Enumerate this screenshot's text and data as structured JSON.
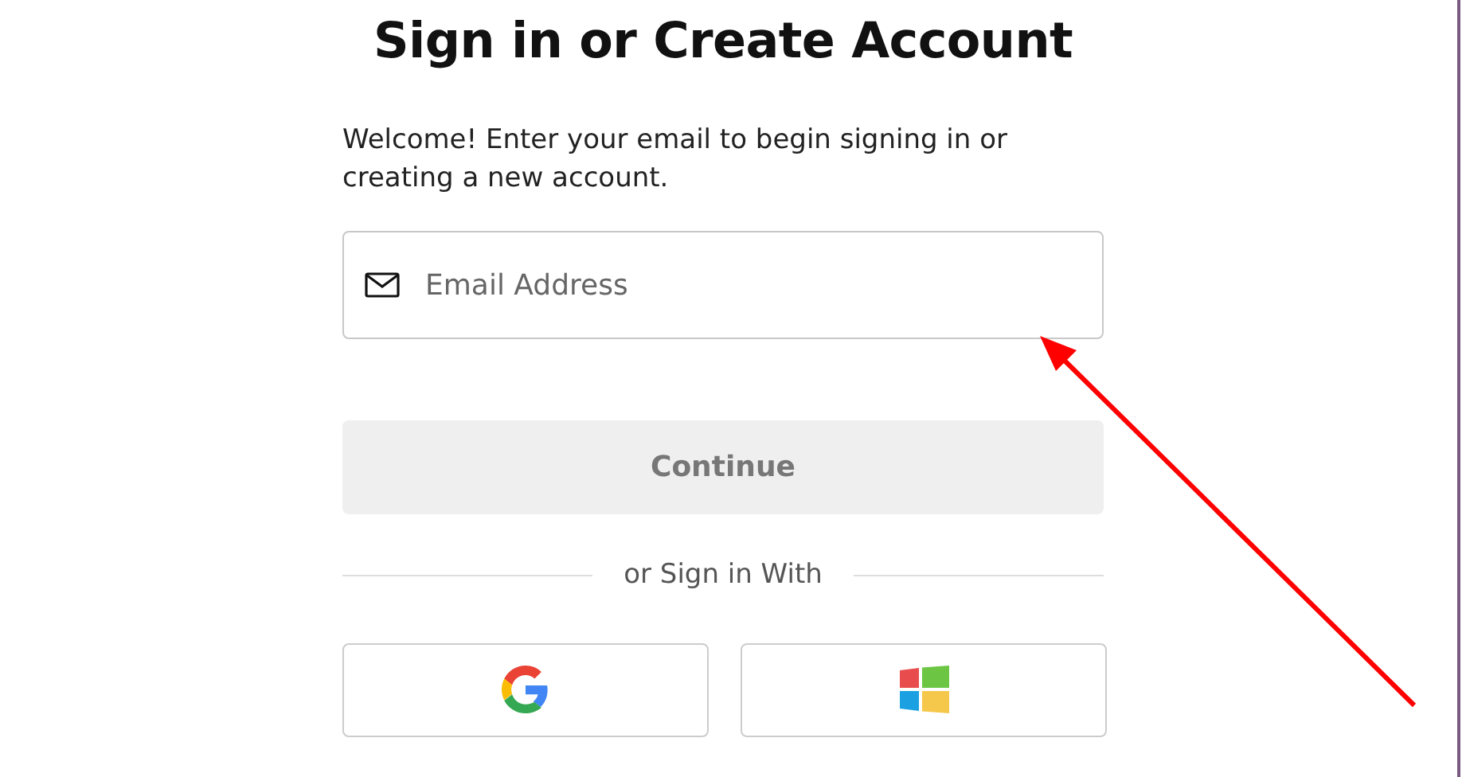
{
  "title": "Sign in or Create Account",
  "intro": "Welcome! Enter your email to begin signing in or creating a new account.",
  "email_field": {
    "placeholder": "Email Address"
  },
  "continue_button": {
    "label": "Continue",
    "disabled": true
  },
  "divider": "or Sign in With",
  "social_buttons": [
    {
      "kind": "google"
    },
    {
      "kind": "windows"
    }
  ]
}
